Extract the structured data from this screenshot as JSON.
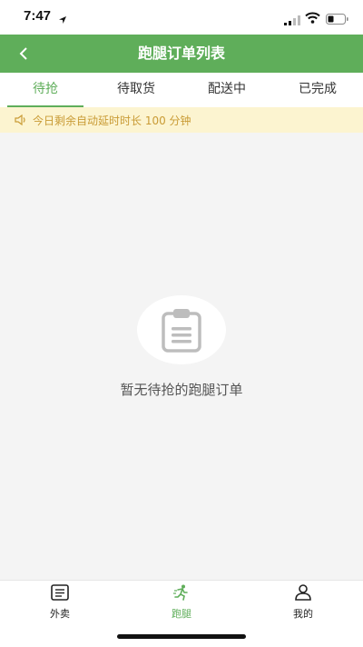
{
  "status_bar": {
    "time": "7:47"
  },
  "header": {
    "title": "跑腿订单列表"
  },
  "tabs": [
    {
      "label": "待抢",
      "active": true
    },
    {
      "label": "待取货",
      "active": false
    },
    {
      "label": "配送中",
      "active": false
    },
    {
      "label": "已完成",
      "active": false
    }
  ],
  "notice": {
    "text": "今日剩余自动延时时长 100 分钟"
  },
  "empty_state": {
    "message": "暂无待抢的跑腿订单"
  },
  "bottom_nav": [
    {
      "label": "外卖",
      "icon": "document-list-icon",
      "active": false
    },
    {
      "label": "跑腿",
      "icon": "runner-icon",
      "active": true
    },
    {
      "label": "我的",
      "icon": "user-icon",
      "active": false
    }
  ],
  "colors": {
    "brand_green": "#5fae5a",
    "notice_bg": "#fcf4d0",
    "notice_text": "#c99b35"
  }
}
